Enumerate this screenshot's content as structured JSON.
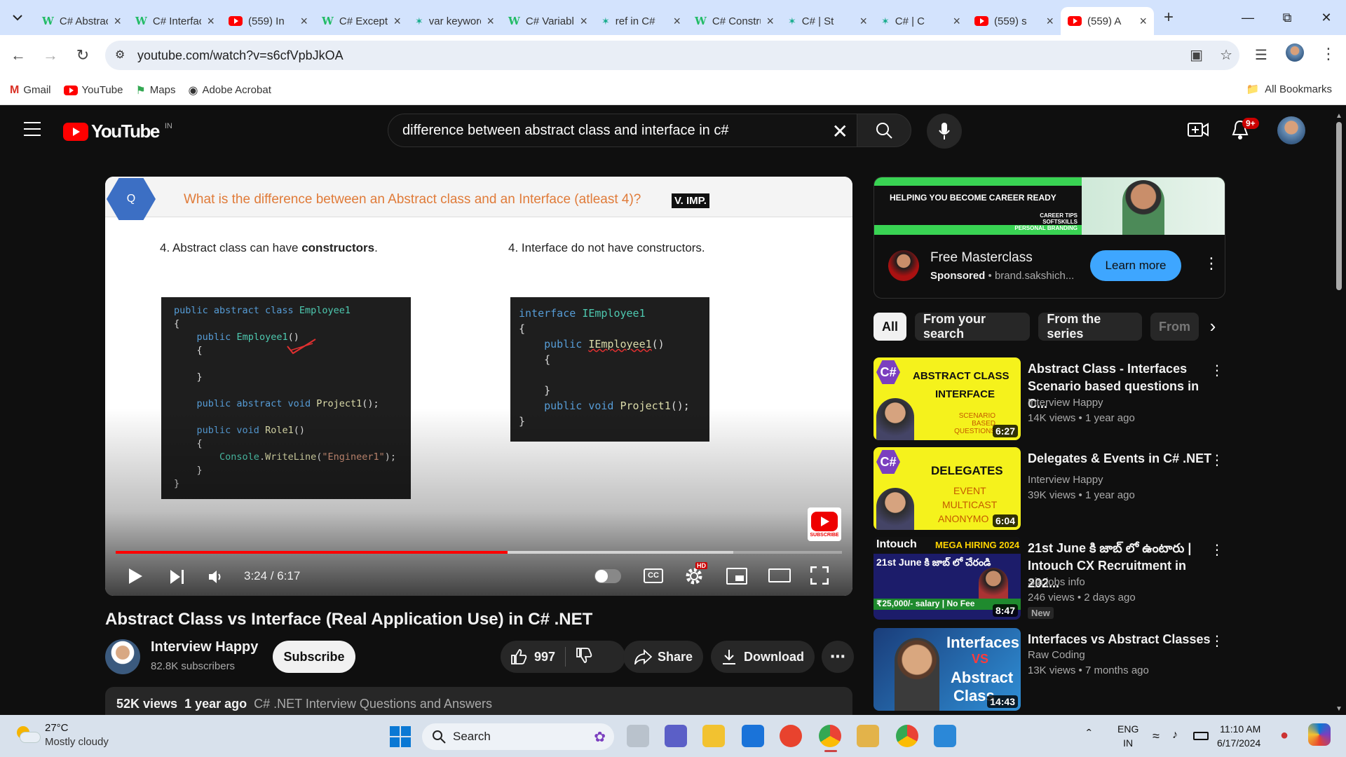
{
  "browser": {
    "tabs": [
      {
        "title": "C# Abstract",
        "icon": "w"
      },
      {
        "title": "C# Interface",
        "icon": "w"
      },
      {
        "title": "(559) In",
        "icon": "yt"
      },
      {
        "title": "C# Exceptions",
        "icon": "w"
      },
      {
        "title": "var keyword",
        "icon": "g"
      },
      {
        "title": "C# Variables",
        "icon": "w"
      },
      {
        "title": "ref in C#",
        "icon": "g"
      },
      {
        "title": "C# Constructors",
        "icon": "w"
      },
      {
        "title": "C# | St",
        "icon": "g"
      },
      {
        "title": "C# | C",
        "icon": "g"
      },
      {
        "title": "(559) s",
        "icon": "yt"
      },
      {
        "title": "(559) A",
        "icon": "yt",
        "active": true
      }
    ],
    "url": "youtube.com/watch?v=s6cfVpbJkOA",
    "bookmarks": [
      "Gmail",
      "YouTube",
      "Maps",
      "Adobe Acrobat"
    ],
    "all_bookmarks": "All Bookmarks"
  },
  "yt": {
    "logo_text": "YouTube",
    "country": "IN",
    "search_query": "difference between abstract class and interface in c#",
    "notif_count": "9+"
  },
  "slide": {
    "q_badge": "Q",
    "question": "What is the difference between an Abstract class and an Interface (atleast 4)?",
    "vimp": "V. IMP.",
    "left_point_pre": "4. Abstract class can have ",
    "left_point_bold": "constructors",
    "left_point_post": ".",
    "right_point": "4. Interface do not have constructors.",
    "subscribe_label": "SUBSCRIBE"
  },
  "player": {
    "time": "3:24 / 6:17",
    "progress": 0.54,
    "buffered": 0.85,
    "hd_badge": "HD"
  },
  "video": {
    "title": "Abstract Class vs Interface (Real Application Use) in C# .NET",
    "channel": "Interview Happy",
    "subscribers": "82.8K subscribers",
    "subscribe": "Subscribe",
    "likes": "997",
    "share": "Share",
    "download": "Download",
    "views": "52K views",
    "age": "1 year ago",
    "playlist": "C# .NET Interview Questions and Answers"
  },
  "ad": {
    "banner_title": "HELPING YOU BECOME CAREER READY",
    "banner_lines": [
      "CAREER TIPS",
      "SOFTSKILLS",
      "PERSONAL BRANDING"
    ],
    "title": "Free Masterclass",
    "sponsored": "Sponsored",
    "domain": "brand.sakshich...",
    "cta": "Learn more"
  },
  "chips": [
    "All",
    "From your search",
    "From the series",
    "From"
  ],
  "recommendations": [
    {
      "title": "Abstract Class - Interfaces Scenario based questions in C...",
      "channel": "Interview Happy",
      "meta": "14K views • 1 year ago",
      "duration": "6:27",
      "thumb_l1": "ABSTRACT CLASS",
      "thumb_l2": "INTERFACE",
      "thumb_l3": "SCENARIO BASED QUESTIONS"
    },
    {
      "title": "Delegates & Events in C# .NET",
      "channel": "Interview Happy",
      "meta": "39K views • 1 year ago",
      "duration": "6:04",
      "thumb_l1": "DELEGATES",
      "thumb_l2": "EVENT",
      "thumb_l3": "MULTICAST",
      "thumb_l4": "ANONYMO"
    },
    {
      "title": "21st June కి జాబ్ లో ఉంటారు | Intouch CX Recruitment in 202...",
      "channel": "Sja jobs info",
      "meta": "246 views • 2 days ago",
      "duration": "8:47",
      "badge": "New",
      "thumb_l1": "Intouch",
      "thumb_l2": "MEGA HIRING 2024",
      "thumb_l3": "21st June కి జాబ్ లో చేరండి",
      "thumb_l4": "₹25,000/- salary | No Fee"
    },
    {
      "title": "Interfaces vs Abstract Classes",
      "channel": "Raw Coding",
      "meta": "13K views • 7 months ago",
      "duration": "14:43",
      "thumb_l1": "Interfaces",
      "thumb_l2": "VS",
      "thumb_l3": "Abstract",
      "thumb_l4": "Class"
    }
  ],
  "taskbar": {
    "temp": "27°C",
    "weather": "Mostly cloudy",
    "search": "Search",
    "lang1": "ENG",
    "lang2": "IN",
    "time": "11:10 AM",
    "date": "6/17/2024"
  }
}
